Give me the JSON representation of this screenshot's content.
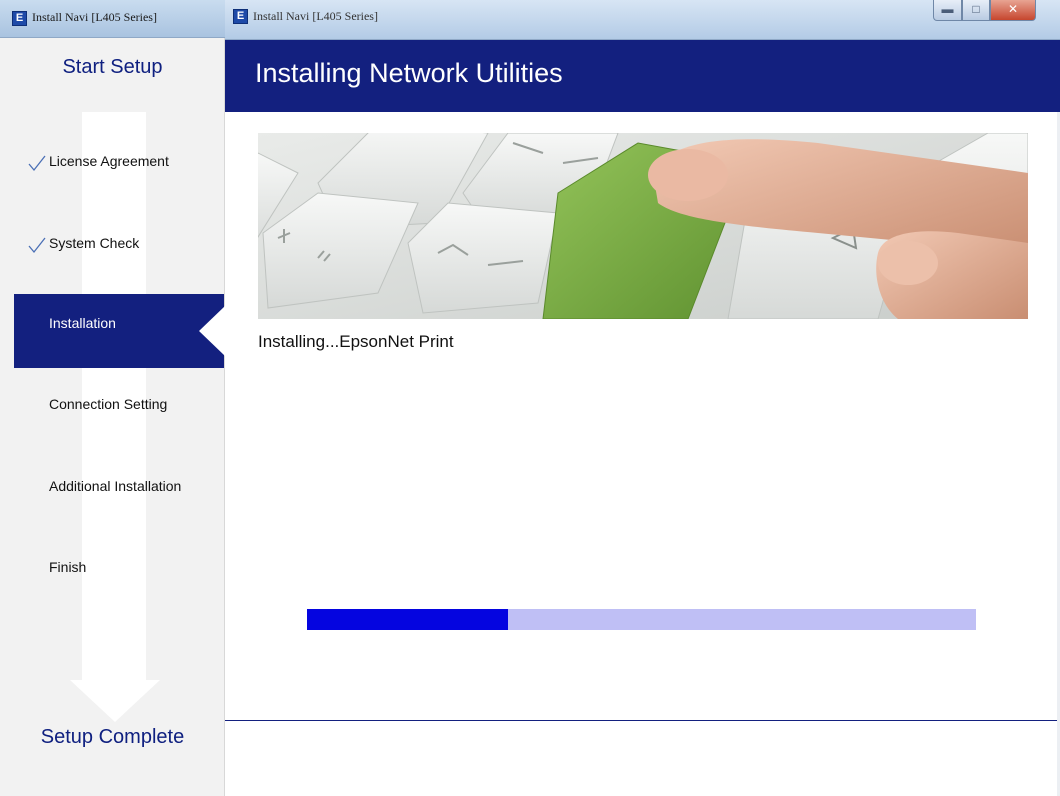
{
  "side_window": {
    "title": "Install Navi [L405 Series]",
    "start_label": "Start Setup",
    "end_label": "Setup Complete",
    "steps": [
      {
        "label": "License Agreement",
        "state": "done"
      },
      {
        "label": "System Check",
        "state": "done"
      },
      {
        "label": "Installation",
        "state": "current"
      },
      {
        "label": "Connection Setting",
        "state": "pending"
      },
      {
        "label": "Additional Installation",
        "state": "pending"
      },
      {
        "label": "Finish",
        "state": "pending"
      }
    ]
  },
  "main_window": {
    "title": "Install Navi [L405 Series]",
    "heading": "Installing Network Utilities",
    "status": "Installing...EpsonNet Print",
    "progress": 0.3
  },
  "icons": {
    "app": "epson-installer-icon",
    "check": "checkmark-icon",
    "minimize": "minimize-icon",
    "maximize": "maximize-icon",
    "close": "close-icon"
  },
  "colors": {
    "brand_navy": "#13207f",
    "progress_fill": "#0505e0",
    "progress_track": "#bfbff5",
    "key_green": "#7fb140"
  }
}
